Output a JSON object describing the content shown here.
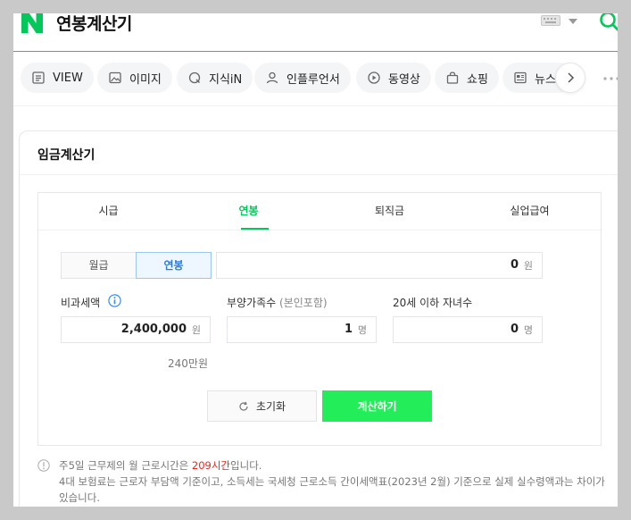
{
  "header": {
    "title": "연봉계산기",
    "brand_color": "#03c75a"
  },
  "nav": {
    "items": [
      {
        "label": "VIEW",
        "icon": "view-icon"
      },
      {
        "label": "이미지",
        "icon": "image-icon"
      },
      {
        "label": "지식iN",
        "icon": "kin-icon"
      },
      {
        "label": "인플루언서",
        "icon": "person-icon"
      },
      {
        "label": "동영상",
        "icon": "play-icon"
      },
      {
        "label": "쇼핑",
        "icon": "bag-icon"
      },
      {
        "label": "뉴스",
        "icon": "news-icon"
      }
    ]
  },
  "card": {
    "title": "임금계산기",
    "tabs": [
      "시급",
      "연봉",
      "퇴직금",
      "실업급여"
    ],
    "active_tab": "연봉",
    "period": {
      "month_label": "월급",
      "year_label": "연봉",
      "selected": "연봉"
    },
    "salary": {
      "value": "0",
      "unit": "원"
    },
    "nontax": {
      "label": "비과세액",
      "value": "2,400,000",
      "unit": "원",
      "hint": "240만원"
    },
    "dependents": {
      "label": "부양가족수",
      "label_sub": "(본인포함)",
      "value": "1",
      "unit": "명"
    },
    "children": {
      "label": "20세 이하 자녀수",
      "value": "0",
      "unit": "명"
    },
    "reset_label": "초기화",
    "calc_label": "계산하기",
    "calc_color": "#23ee5a"
  },
  "notes": {
    "line1_before": "주5일 근무제의 월 근로시간은 ",
    "line1_highlight": "209시간",
    "line1_after": "입니다.",
    "line2": "4대 보험료는 근로자 부담액 기준이고, 소득세는 국세청 근로소득 간이세액표(2023년 2월) 기준으로 실제 실수령액과는 차이가 있습니다."
  }
}
